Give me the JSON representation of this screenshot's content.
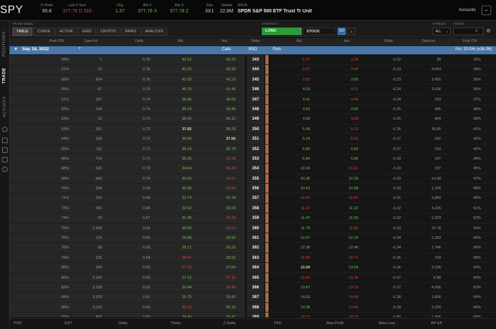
{
  "quote": {
    "symbol": "SPY",
    "cols": [
      {
        "label": "IV Rank",
        "value": "65.8",
        "color": "#cfcfcf"
      },
      {
        "label": "Last X Size",
        "value": "377.76 D 315",
        "color": "#e04a4a"
      },
      {
        "label": "Chg",
        "value": "1.37",
        "color": "#6dc14a"
      },
      {
        "label": "Bid X",
        "value": "377.76 X",
        "color": "#6dc14a"
      },
      {
        "label": "Ask X",
        "value": "377.78 Z",
        "color": "#6dc14a"
      },
      {
        "label": "Size",
        "value": "3X1",
        "color": "#cfcfcf"
      },
      {
        "label": "Volume",
        "value": "22.8M",
        "color": "#cfcfcf"
      }
    ],
    "desc_label": "ARCA",
    "description": "SPDR S&P 500 ETF Trust Tr Unit",
    "accounts_label": "Accounts"
  },
  "sidebar": {
    "tabs": [
      "POSITIONS",
      "TRADE",
      "ACTIVITY"
    ],
    "active": "TRADE"
  },
  "viewbar": {
    "mode_label": "TRADE MODE",
    "tabs": [
      "TABLE",
      "CURVE",
      "ACTIVE",
      "GRID",
      "CRYPTO",
      "PAIRS",
      "ANALYSIS"
    ],
    "active_tab": "TABLE",
    "strategy_label": "STRATEGY",
    "strategy_long": "LONG",
    "strategy_stock": "STOCK",
    "go_label": "GO",
    "strikes_label": "STRIKES",
    "strikes_value": "ALL",
    "filter_label": "FILTER"
  },
  "chain": {
    "headers": {
      "call_pct": "Prob ITM",
      "call_oi": "Open Int",
      "call_delta": "Delta",
      "call_bid": "Bid",
      "call_ask": "Ask",
      "strike": "Strike",
      "put_bid": "Bid",
      "put_ask": "Ask",
      "put_delta": "Delta",
      "put_oi": "Open Int",
      "put_pct": "Prob ITM"
    },
    "expiration": {
      "label": "Sep 16, 2022",
      "calls": "Calls",
      "bsd": "BSD",
      "puts": "Puts",
      "right": "IVx: 20.0% (±36.96)"
    },
    "rows": [
      {
        "cp": "50%",
        "coi": "1",
        "cd": "0.76",
        "cb": "43.12",
        "cbc": "green",
        "ca": "43.20",
        "cac": "green",
        "strike": "343",
        "pb": "3.27",
        "pbc": "red",
        "pa": "3.34",
        "pac": "red",
        "pd": "-0.22",
        "poi": "30",
        "pp": "33%"
      },
      {
        "cp": "51%",
        "coi": "16",
        "cd": "0.76",
        "cb": "42.20",
        "cbc": "green",
        "ca": "42.30",
        "cac": "green",
        "strike": "344",
        "pb": "3.37",
        "pbc": "red",
        "pa": "3.44",
        "pac": "red",
        "pd": "-0.23",
        "poi": "4,694",
        "pp": "34%"
      },
      {
        "cp": "58%",
        "coi": "814",
        "cd": "0.75",
        "cb": "41.53",
        "cbc": "green",
        "ca": "42.23",
        "cac": "green",
        "strike": "345",
        "pb": "3.53",
        "pbc": "red",
        "pa": "3.60",
        "pac": "green",
        "pd": "-0.23",
        "poi": "3,455",
        "pp": "35%"
      },
      {
        "cp": "59%",
        "coi": "67",
        "cd": "0.75",
        "cb": "40.75",
        "cbc": "green",
        "ca": "41.45",
        "cac": "green",
        "strike": "346",
        "pb": "4.29",
        "pbc": "green",
        "pa": "4.37",
        "pac": "red",
        "pd": "-0.24",
        "poi": "3,636",
        "pp": "36%"
      },
      {
        "cp": "61%",
        "coi": "167",
        "cd": "0.74",
        "cb": "39.96",
        "cbc": "green",
        "ca": "40.66",
        "cac": "green",
        "strike": "347",
        "pb": "4.41",
        "pbc": "green",
        "pa": "4.49",
        "pac": "red",
        "pd": "-0.24",
        "poi": "153",
        "pp": "37%"
      },
      {
        "cp": "62%",
        "coi": "134",
        "cd": "0.74",
        "cb": "39.19",
        "cbc": "green",
        "ca": "39.49",
        "cac": "green",
        "strike": "348",
        "pb": "4.53",
        "pbc": "green",
        "pa": "4.60",
        "pac": "green",
        "pd": "-0.25",
        "poi": "445",
        "pp": "38%"
      },
      {
        "cp": "63%",
        "coi": "16",
        "cd": "0.73",
        "cb": "38.42",
        "cbc": "green",
        "ca": "39.12",
        "cac": "green",
        "strike": "349",
        "pb": "4.66",
        "pbc": "green",
        "pa": "4.69",
        "pac": "red",
        "pd": "-0.25",
        "poi": "464",
        "pp": "39%"
      },
      {
        "cp": "63%",
        "coi": "161",
        "cd": "0.73",
        "cb": "37.65",
        "cbc": "hl-green",
        "ca": "38.33",
        "cac": "green",
        "strike": "350",
        "pb": "5.09",
        "pbc": "green",
        "pa": "5.13",
        "pac": "red",
        "pd": "-0.26",
        "poi": "35,86",
        "pp": "41%"
      },
      {
        "cp": "64%",
        "coi": "130",
        "cd": "0.72",
        "cb": "36.89",
        "cbc": "green",
        "ca": "37.56",
        "cac": "hl-green",
        "strike": "351",
        "pb": "5.24",
        "pbc": "green",
        "pa": "5.31",
        "pac": "red",
        "pd": "-0.27",
        "poi": "182",
        "pp": "42%"
      },
      {
        "cp": "65%",
        "coi": "111",
        "cd": "0.72",
        "cb": "36.14",
        "cbc": "green",
        "ca": "36.79",
        "cac": "green",
        "strike": "352",
        "pb": "5.55",
        "pbc": "green",
        "pa": "5.62",
        "pac": "green",
        "pd": "-0.27",
        "poi": "150",
        "pp": "42%"
      },
      {
        "cp": "66%",
        "coi": "714",
        "cd": "0.71",
        "cb": "35.39",
        "cbc": "green",
        "ca": "36.08",
        "cac": "red",
        "strike": "353",
        "pb": "5.84",
        "pbc": "green",
        "pa": "5.90",
        "pac": "green",
        "pd": "-0.28",
        "poi": "197",
        "pp": "44%"
      },
      {
        "cp": "68%",
        "coi": "626",
        "cd": "0.70",
        "cb": "34.64",
        "cbc": "green",
        "ca": "35.34",
        "cac": "red",
        "strike": "354",
        "pb": "10.16",
        "pbc": "green",
        "pa": "10.21",
        "pac": "red",
        "pd": "-0.29",
        "poi": "187",
        "pp": "45%"
      },
      {
        "cp": "69%",
        "coi": "640",
        "cd": "0.70",
        "cb": "34.20",
        "cbc": "green",
        "ca": "34.57",
        "cac": "red",
        "strike": "355",
        "pb": "10.36",
        "pbc": "green",
        "pa": "10.39",
        "pac": "green",
        "pd": "-0.29",
        "poi": "14.38",
        "pp": "47%"
      },
      {
        "cp": "70%",
        "coi": "254",
        "cd": "0.69",
        "cb": "33.46",
        "cbc": "green",
        "ca": "33.84",
        "cac": "red",
        "strike": "356",
        "pb": "10.63",
        "pbc": "green",
        "pa": "10.68",
        "pac": "green",
        "pd": "-0.30",
        "poi": "1,226",
        "pp": "48%"
      },
      {
        "cp": "71%",
        "coi": "315",
        "cd": "0.68",
        "cb": "32.74",
        "cbc": "green",
        "ca": "32.78",
        "cac": "green",
        "strike": "357",
        "pb": "10.91",
        "pbc": "red",
        "pa": "10.97",
        "pac": "red",
        "pd": "-0.31",
        "poi": "3,860",
        "pp": "49%"
      },
      {
        "cp": "73%",
        "coi": "363",
        "cd": "0.68",
        "cb": "32.02",
        "cbc": "green",
        "ca": "32.09",
        "cac": "green",
        "strike": "358",
        "pb": "11.21",
        "pbc": "red",
        "pa": "11.22",
        "pac": "green",
        "pd": "-0.32",
        "poi": "4,226",
        "pp": "51%"
      },
      {
        "cp": "74%",
        "coi": "43",
        "cd": "0.67",
        "cb": "31.30",
        "cbc": "green",
        "ca": "31.33",
        "cac": "red",
        "strike": "359",
        "pb": "11.47",
        "pbc": "green",
        "pa": "11.50",
        "pac": "green",
        "pd": "-0.32",
        "poi": "1,224",
        "pp": "52%"
      },
      {
        "cp": "75%",
        "coi": "1,106",
        "cd": "0.66",
        "cb": "30.56",
        "cbc": "green",
        "ca": "30.63",
        "cac": "red",
        "strike": "360",
        "pb": "11.76",
        "pbc": "green",
        "pa": "11.80",
        "pac": "red",
        "pd": "-0.33",
        "poi": "15.78",
        "pp": "54%"
      },
      {
        "cp": "76%",
        "coi": "114",
        "cd": "0.65",
        "cb": "29.88",
        "cbc": "green",
        "ca": "29.92",
        "cac": "green",
        "strike": "361",
        "pb": "12.07",
        "pbc": "green",
        "pa": "12.10",
        "pac": "green",
        "pd": "-0.34",
        "poi": "1,269",
        "pp": "55%"
      },
      {
        "cp": "78%",
        "coi": "83",
        "cd": "0.65",
        "cb": "29.17",
        "cbc": "green",
        "ca": "29.22",
        "cac": "green",
        "strike": "362",
        "pb": "12.36",
        "pbc": "green",
        "pa": "12.40",
        "pac": "green",
        "pd": "-0.34",
        "poi": "1,746",
        "pp": "56%"
      },
      {
        "cp": "79%",
        "coi": "126",
        "cd": "0.64",
        "cb": "28.47",
        "cbc": "red",
        "ca": "28.52",
        "cac": "green",
        "strike": "363",
        "pb": "12.68",
        "pbc": "red",
        "pa": "12.71",
        "pac": "red",
        "pd": "-0.35",
        "poi": "718",
        "pp": "58%"
      },
      {
        "cp": "80%",
        "coi": "304",
        "cd": "0.63",
        "cb": "27.78",
        "cbc": "red",
        "ca": "27.84",
        "cac": "green",
        "strike": "364",
        "pb": "13.00",
        "pbc": "hl-green",
        "pa": "13.04",
        "pac": "green",
        "pd": "-0.36",
        "poi": "3,106",
        "pp": "59%"
      },
      {
        "cp": "82%",
        "coi": "2,140",
        "cd": "0.63",
        "cb": "27.12",
        "cbc": "green",
        "ca": "27.16",
        "cac": "red",
        "strike": "365",
        "pb": "13.32",
        "pbc": "red",
        "pa": "13.36",
        "pac": "red",
        "pd": "-0.37",
        "poi": "6.88",
        "pp": "60%"
      },
      {
        "cp": "83%",
        "coi": "3,108",
        "cd": "0.62",
        "cb": "26.44",
        "cbc": "green",
        "ca": "26.49",
        "cac": "red",
        "strike": "366",
        "pb": "13.67",
        "pbc": "green",
        "pa": "13.73",
        "pac": "red",
        "pd": "-0.37",
        "poi": "4,636",
        "pp": "62%"
      },
      {
        "cp": "84%",
        "coi": "3,120",
        "cd": "0.61",
        "cb": "25.79",
        "cbc": "green",
        "ca": "25.82",
        "cac": "green",
        "strike": "367",
        "pb": "14.03",
        "pbc": "green",
        "pa": "14.06",
        "pac": "red",
        "pd": "-0.38",
        "poi": "1,656",
        "pp": "64%"
      },
      {
        "cp": "86%",
        "coi": "3,116",
        "cd": "0.60",
        "cb": "25.13",
        "cbc": "red",
        "ca": "25.16",
        "cac": "green",
        "strike": "368",
        "pb": "14.38",
        "pbc": "green",
        "pa": "14.40",
        "pac": "red",
        "pd": "-0.39",
        "poi": "3,226",
        "pp": "66%"
      },
      {
        "cp": "87%",
        "coi": "403",
        "cd": "0.60",
        "cb": "24.40",
        "cbc": "green",
        "ca": "24.47",
        "cac": "green",
        "strike": "369",
        "pb": "14.72",
        "pbc": "red",
        "pa": "14.75",
        "pac": "red",
        "pd": "-0.40",
        "poi": "1,666",
        "pp": "68%"
      }
    ]
  },
  "bottom": [
    "POP",
    "EXT",
    "Delta",
    "Theta",
    "Z Delta",
    "P50",
    "Max Profit",
    "Max Loss",
    "BP Eff"
  ]
}
